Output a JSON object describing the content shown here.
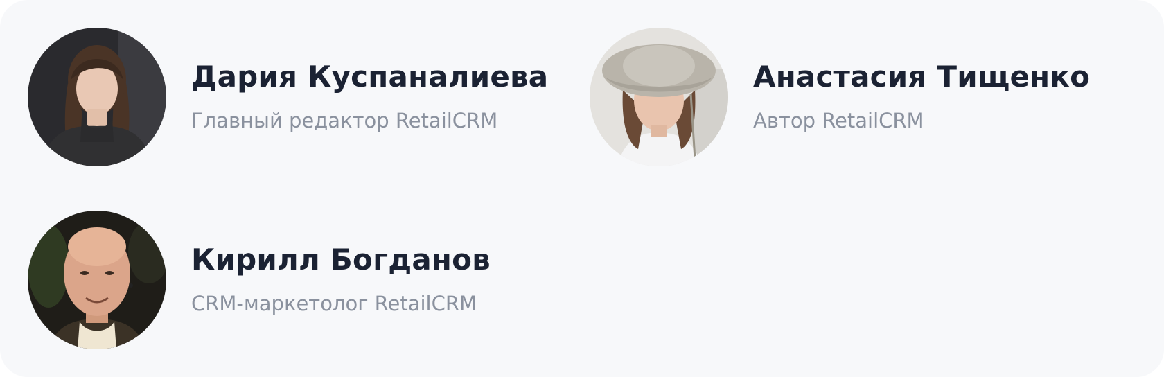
{
  "authors": [
    {
      "name": "Дария Куспаналиева",
      "role": "Главный редактор RetailCRM"
    },
    {
      "name": "Анастасия Тищенко",
      "role": "Автор RetailCRM"
    },
    {
      "name": "Кирилл Богданов",
      "role": "CRM-маркетолог RetailCRM"
    }
  ],
  "colors": {
    "card_background": "#f7f8fa",
    "name_text": "#1b2233",
    "role_text": "#8a919e"
  }
}
